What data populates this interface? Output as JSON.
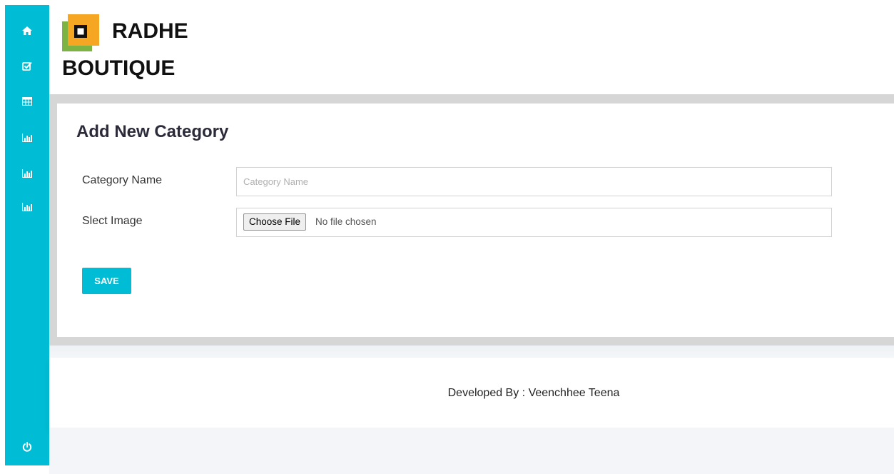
{
  "brand": {
    "line1": "RADHE",
    "line2": "BOUTIQUE",
    "logo_colors": {
      "orange": "#f5a623",
      "green": "#7cb342",
      "inner": "#111111"
    }
  },
  "sidebar": {
    "color": "#00bcd4",
    "items": [
      {
        "icon": "home-icon"
      },
      {
        "icon": "checkbox-icon"
      },
      {
        "icon": "table-icon"
      },
      {
        "icon": "bar-chart-icon"
      },
      {
        "icon": "bar-chart-icon"
      },
      {
        "icon": "bar-chart-icon"
      }
    ],
    "logout_icon": "power-icon"
  },
  "form": {
    "title": "Add New Category",
    "category_label": "Category Name",
    "category_placeholder": "Category Name",
    "category_value": "",
    "image_label": "Slect Image",
    "file_button": "Choose File",
    "file_status": "No file chosen",
    "save_label": "SAVE"
  },
  "footer": {
    "text": "Developed By : Veenchhee Teena"
  }
}
